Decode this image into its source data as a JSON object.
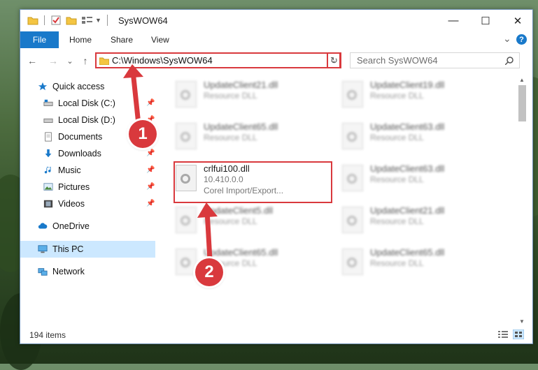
{
  "window": {
    "title": "SysWOW64",
    "minimize": "—",
    "maximize": "☐",
    "close": "✕"
  },
  "ribbon": {
    "tabs": [
      "File",
      "Home",
      "Share",
      "View"
    ],
    "expand": "⌄",
    "help": "?"
  },
  "nav": {
    "back": "←",
    "forward": "→",
    "recent": "⌄",
    "up": "↑",
    "address": "C:\\Windows\\SysWOW64",
    "search_placeholder": "Search SysWOW64"
  },
  "sidebar": {
    "items": [
      {
        "label": "Quick access",
        "icon": "star-icon"
      },
      {
        "label": "Local Disk (C:)",
        "icon": "drive-icon"
      },
      {
        "label": "Local Disk (D:)",
        "icon": "drive-icon"
      },
      {
        "label": "Documents",
        "icon": "documents-icon"
      },
      {
        "label": "Downloads",
        "icon": "download-icon"
      },
      {
        "label": "Music",
        "icon": "music-icon"
      },
      {
        "label": "Pictures",
        "icon": "pictures-icon"
      },
      {
        "label": "Videos",
        "icon": "videos-icon"
      },
      {
        "label": "OneDrive",
        "icon": "cloud-icon"
      },
      {
        "label": "This PC",
        "icon": "computer-icon"
      },
      {
        "label": "Network",
        "icon": "network-icon"
      }
    ]
  },
  "files": [
    {
      "name": "UpdateClient21.dll",
      "desc": "Resource DLL"
    },
    {
      "name": "UpdateClient19.dll",
      "desc": "Resource DLL"
    },
    {
      "name": "UpdateClient65.dll",
      "desc": "Resource DLL"
    },
    {
      "name": "UpdateClient63.dll",
      "desc": "Resource DLL"
    },
    {
      "name": "crlfui100.dll",
      "version": "10.410.0.0",
      "desc": "Corel Import/Export..."
    },
    {
      "name": "UpdateClient63.dll",
      "desc": "Resource DLL"
    },
    {
      "name": "UpdateClient5.dll",
      "desc": "Resource DLL"
    },
    {
      "name": "UpdateClient21.dll",
      "desc": "Resource DLL"
    },
    {
      "name": "UpdateClient65.dll",
      "desc": "Resource DLL"
    },
    {
      "name": "UpdateClient65.dll",
      "desc": "Resource DLL"
    }
  ],
  "status": {
    "items": "194 items"
  },
  "callouts": {
    "one": "1",
    "two": "2"
  },
  "colors": {
    "accent": "#1979ca",
    "highlight": "#d9393d",
    "selected": "#cce8ff"
  }
}
